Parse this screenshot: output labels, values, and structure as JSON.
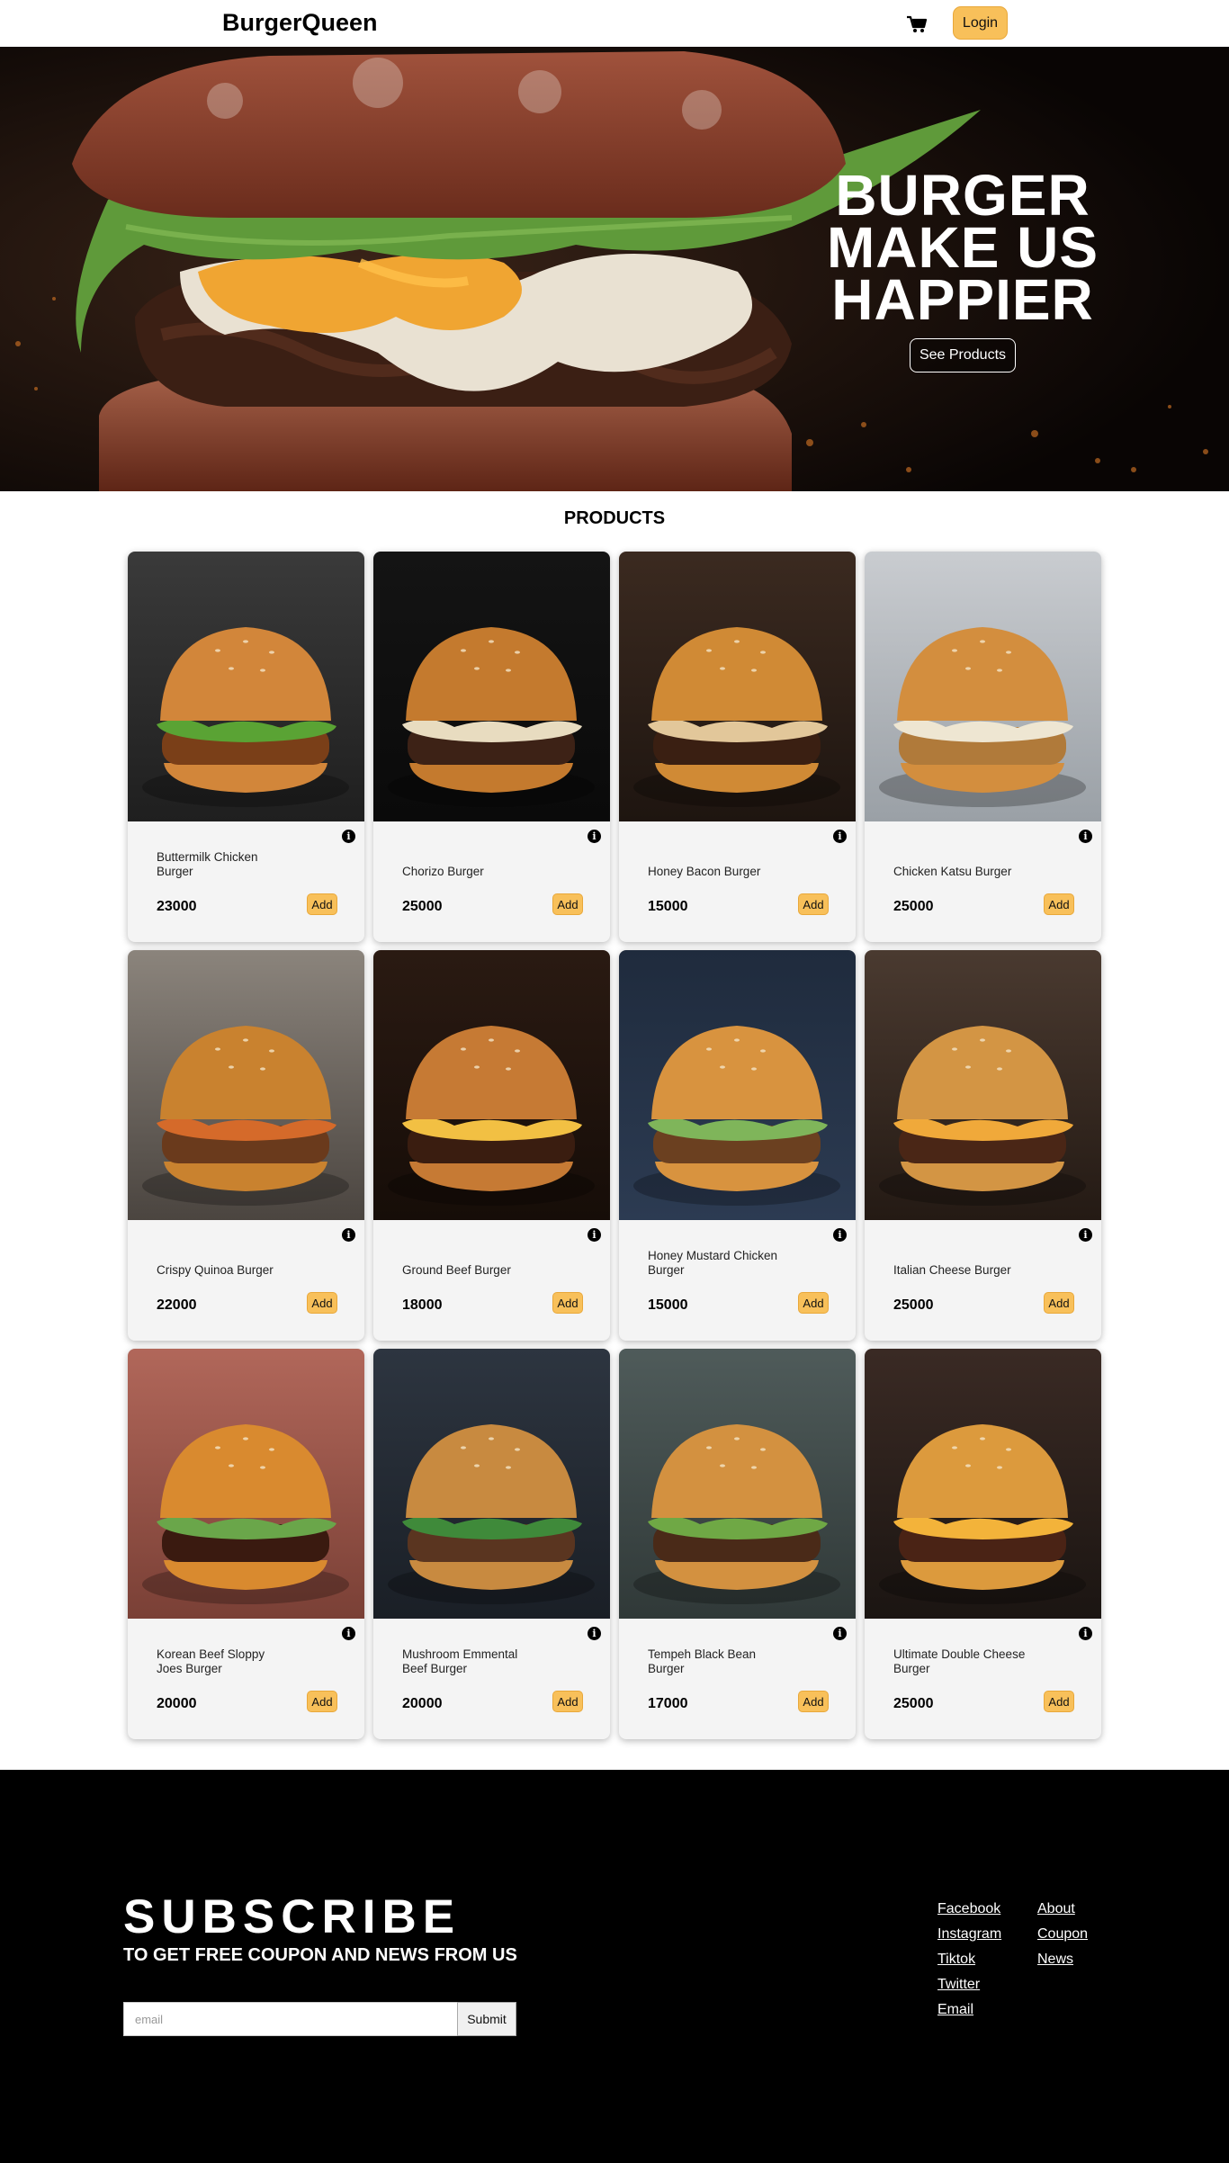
{
  "nav": {
    "brand": "BurgerQueen",
    "cart_icon": "cart-icon",
    "login_label": "Login"
  },
  "hero": {
    "lines": [
      "BURGER",
      "MAKE US",
      "HAPPIER"
    ],
    "cta_label": "See Products"
  },
  "products": {
    "title": "PRODUCTS",
    "add_label": "Add",
    "info_glyph": "i",
    "items": [
      {
        "name": "Buttermilk Chicken Burger",
        "price": "23000"
      },
      {
        "name": "Chorizo Burger",
        "price": "25000"
      },
      {
        "name": "Honey Bacon Burger",
        "price": "15000"
      },
      {
        "name": "Chicken Katsu Burger",
        "price": "25000"
      },
      {
        "name": "Crispy Quinoa Burger",
        "price": "22000"
      },
      {
        "name": "Ground Beef Burger",
        "price": "18000"
      },
      {
        "name": "Honey Mustard Chicken Burger",
        "price": "15000"
      },
      {
        "name": "Italian Cheese Burger",
        "price": "25000"
      },
      {
        "name": "Korean Beef Sloppy Joes Burger",
        "price": "20000"
      },
      {
        "name": "Mushroom Emmental Beef Burger",
        "price": "20000"
      },
      {
        "name": "Tempeh Black Bean Burger",
        "price": "17000"
      },
      {
        "name": "Ultimate Double Cheese Burger",
        "price": "25000"
      }
    ]
  },
  "footer": {
    "title": "SUBSCRIBE",
    "subtitle": "TO GET FREE COUPON AND NEWS FROM US",
    "email_placeholder": "email",
    "submit_label": "Submit",
    "links_col1": [
      "Facebook",
      "Instagram",
      "Tiktok",
      "Twitter",
      "Email"
    ],
    "links_col2": [
      "About",
      "Coupon",
      "News"
    ]
  },
  "colors": {
    "accent": "#f8c05a",
    "footer_bg": "#000000"
  }
}
